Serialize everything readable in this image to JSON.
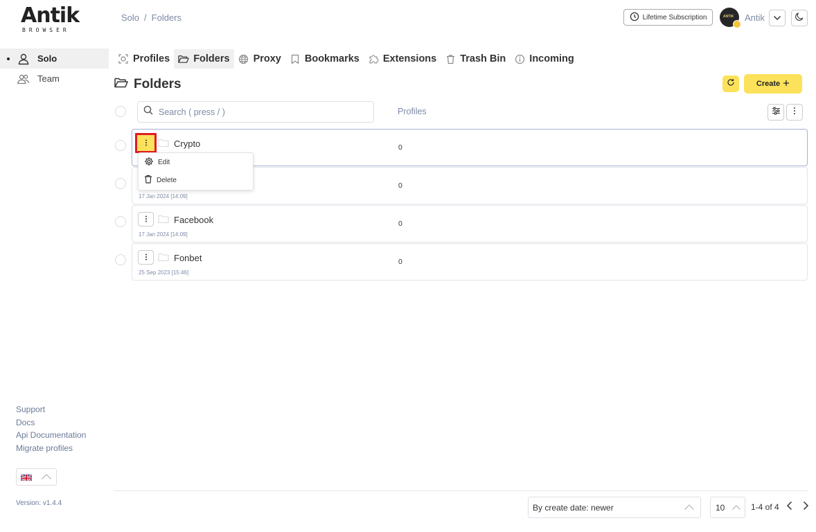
{
  "logo": {
    "word": "Antik",
    "sub": "BROWSER"
  },
  "sidebar": {
    "items": [
      {
        "label": "Solo",
        "icon": "user-icon",
        "active": true
      },
      {
        "label": "Team",
        "icon": "team-icon",
        "active": false
      }
    ],
    "links": [
      "Support",
      "Docs",
      "Api Documentation",
      "Migrate profiles"
    ],
    "language": "uk-flag",
    "version": "Version: v1.4.4"
  },
  "breadcrumb": {
    "root": "Solo",
    "separator": "/",
    "current": "Folders"
  },
  "header": {
    "subscription_label": "Lifetime Subscription",
    "user_name": "Antik",
    "avatar_text": "ANTIK"
  },
  "tabs": [
    {
      "label": "Profiles",
      "icon": "profiles-icon"
    },
    {
      "label": "Folders",
      "icon": "folder-icon",
      "active": true
    },
    {
      "label": "Proxy",
      "icon": "globe-icon"
    },
    {
      "label": "Bookmarks",
      "icon": "bookmark-icon"
    },
    {
      "label": "Extensions",
      "icon": "puzzle-icon"
    },
    {
      "label": "Trash Bin",
      "icon": "trash-icon"
    },
    {
      "label": "Incoming",
      "icon": "info-icon"
    }
  ],
  "page": {
    "title": "Folders",
    "create_label": "Create",
    "create_icon": "plus-icon"
  },
  "list": {
    "search_placeholder": "Search ( press / )",
    "column_profiles": "Profiles",
    "rows": [
      {
        "name": "Crypto",
        "date": "",
        "profiles": "0"
      },
      {
        "name": "",
        "date": "17 Jan 2024 [14:09]",
        "profiles": "0"
      },
      {
        "name": "Facebook",
        "date": "17 Jan 2024 [14:09]",
        "profiles": "0"
      },
      {
        "name": "Fonbet",
        "date": "25 Sep 2023 [15:46]",
        "profiles": "0"
      }
    ]
  },
  "context_menu": {
    "items": [
      {
        "label": "Edit",
        "icon": "gear-icon"
      },
      {
        "label": "Delete",
        "icon": "trash-icon"
      }
    ]
  },
  "footer": {
    "sort_value": "By create date: newer",
    "page_size": "10",
    "range": "1-4 of 4"
  },
  "colors": {
    "accent": "#fbe25a",
    "muted_text": "#7d8aa6",
    "highlight": "#e31b23"
  }
}
